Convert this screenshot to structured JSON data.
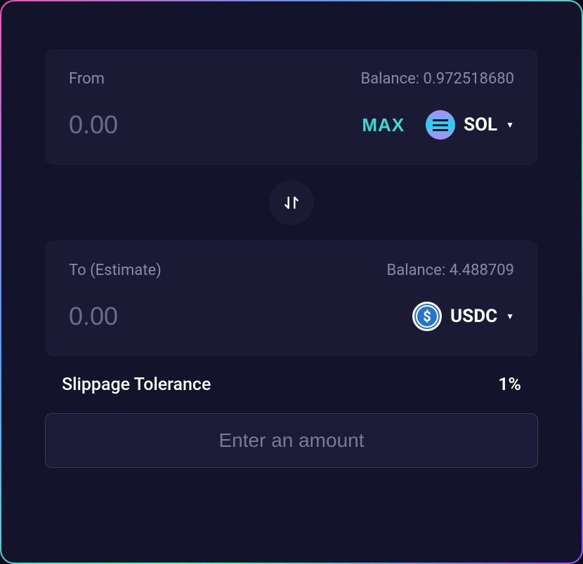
{
  "from": {
    "label": "From",
    "balanceLabel": "Balance: 0.972518680",
    "placeholder": "0.00",
    "maxLabel": "MAX",
    "token": "SOL"
  },
  "to": {
    "label": "To (Estimate)",
    "balanceLabel": "Balance: 4.488709",
    "placeholder": "0.00",
    "token": "USDC"
  },
  "slippage": {
    "label": "Slippage Tolerance",
    "value": "1%"
  },
  "submit": {
    "label": "Enter an amount"
  }
}
